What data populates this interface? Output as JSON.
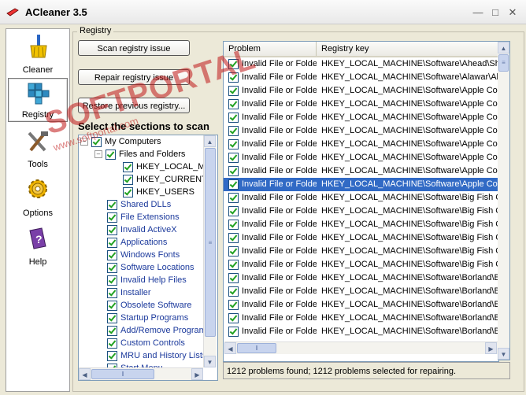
{
  "window": {
    "title": "ACleaner 3.5"
  },
  "sidebar": {
    "items": [
      {
        "label": "Cleaner",
        "icon": "broom-icon"
      },
      {
        "label": "Registry",
        "icon": "registry-cubes-icon"
      },
      {
        "label": "Tools",
        "icon": "tools-icon"
      },
      {
        "label": "Options",
        "icon": "gear-icon"
      },
      {
        "label": "Help",
        "icon": "help-book-icon"
      }
    ]
  },
  "registry": {
    "group_label": "Registry",
    "scan_button": "Scan registry issue",
    "repair_button": "Repair registry issue",
    "restore_button": "Restore previous registry...",
    "sections_title": "Select the sections to scan",
    "tree": [
      {
        "label": "My Computers",
        "level": 0
      },
      {
        "label": "Files and Folders",
        "level": 1
      },
      {
        "label": "HKEY_LOCAL_MA",
        "level": 2
      },
      {
        "label": "HKEY_CURRENT",
        "level": 2
      },
      {
        "label": "HKEY_USERS",
        "level": 2
      },
      {
        "label": "Shared DLLs",
        "level": 1
      },
      {
        "label": "File Extensions",
        "level": 1
      },
      {
        "label": "Invalid ActiveX",
        "level": 1
      },
      {
        "label": "Applications",
        "level": 1
      },
      {
        "label": "Windows Fonts",
        "level": 1
      },
      {
        "label": "Software Locations",
        "level": 1
      },
      {
        "label": "Invalid Help Files",
        "level": 1
      },
      {
        "label": "Installer",
        "level": 1
      },
      {
        "label": "Obsolete Software",
        "level": 1
      },
      {
        "label": "Startup Programs",
        "level": 1
      },
      {
        "label": "Add/Remove Program",
        "level": 1
      },
      {
        "label": "Custom Controls",
        "level": 1
      },
      {
        "label": "MRU and History Lists",
        "level": 1
      },
      {
        "label": "Start Menu",
        "level": 1
      }
    ]
  },
  "results": {
    "columns": [
      "Problem",
      "Registry key"
    ],
    "rows": [
      {
        "problem": "Invalid File or Folder",
        "key": "HKEY_LOCAL_MACHINE\\Software\\Ahead\\Sh"
      },
      {
        "problem": "Invalid File or Folder",
        "key": "HKEY_LOCAL_MACHINE\\Software\\Alawar\\Al"
      },
      {
        "problem": "Invalid File or Folder",
        "key": "HKEY_LOCAL_MACHINE\\Software\\Apple Cor"
      },
      {
        "problem": "Invalid File or Folder",
        "key": "HKEY_LOCAL_MACHINE\\Software\\Apple Cor"
      },
      {
        "problem": "Invalid File or Folder",
        "key": "HKEY_LOCAL_MACHINE\\Software\\Apple Cor"
      },
      {
        "problem": "Invalid File or Folder",
        "key": "HKEY_LOCAL_MACHINE\\Software\\Apple Cor"
      },
      {
        "problem": "Invalid File or Folder",
        "key": "HKEY_LOCAL_MACHINE\\Software\\Apple Cor"
      },
      {
        "problem": "Invalid File or Folder",
        "key": "HKEY_LOCAL_MACHINE\\Software\\Apple Cor"
      },
      {
        "problem": "Invalid File or Folder",
        "key": "HKEY_LOCAL_MACHINE\\Software\\Apple Cor"
      },
      {
        "problem": "Invalid File or Folder",
        "key": "HKEY_LOCAL_MACHINE\\Software\\Apple Cor",
        "selected": true
      },
      {
        "problem": "Invalid File or Folder",
        "key": "HKEY_LOCAL_MACHINE\\Software\\Big Fish G"
      },
      {
        "problem": "Invalid File or Folder",
        "key": "HKEY_LOCAL_MACHINE\\Software\\Big Fish G"
      },
      {
        "problem": "Invalid File or Folder",
        "key": "HKEY_LOCAL_MACHINE\\Software\\Big Fish G"
      },
      {
        "problem": "Invalid File or Folder",
        "key": "HKEY_LOCAL_MACHINE\\Software\\Big Fish G"
      },
      {
        "problem": "Invalid File or Folder",
        "key": "HKEY_LOCAL_MACHINE\\Software\\Big Fish G"
      },
      {
        "problem": "Invalid File or Folder",
        "key": "HKEY_LOCAL_MACHINE\\Software\\Big Fish G"
      },
      {
        "problem": "Invalid File or Folder",
        "key": "HKEY_LOCAL_MACHINE\\Software\\Borland\\B"
      },
      {
        "problem": "Invalid File or Folder",
        "key": "HKEY_LOCAL_MACHINE\\Software\\Borland\\B"
      },
      {
        "problem": "Invalid File or Folder",
        "key": "HKEY_LOCAL_MACHINE\\Software\\Borland\\B"
      },
      {
        "problem": "Invalid File or Folder",
        "key": "HKEY_LOCAL_MACHINE\\Software\\Borland\\B"
      },
      {
        "problem": "Invalid File or Folder",
        "key": "HKEY_LOCAL_MACHINE\\Software\\Borland\\B"
      }
    ],
    "status": "1212 problems found;    1212 problems selected for repairing."
  },
  "watermark": {
    "text": "SOFTPORTAL",
    "sub": "www.softportal.com"
  },
  "colors": {
    "selection": "#316ac5",
    "watermark": "#c01818",
    "link_blue": "#1c3a9c"
  }
}
